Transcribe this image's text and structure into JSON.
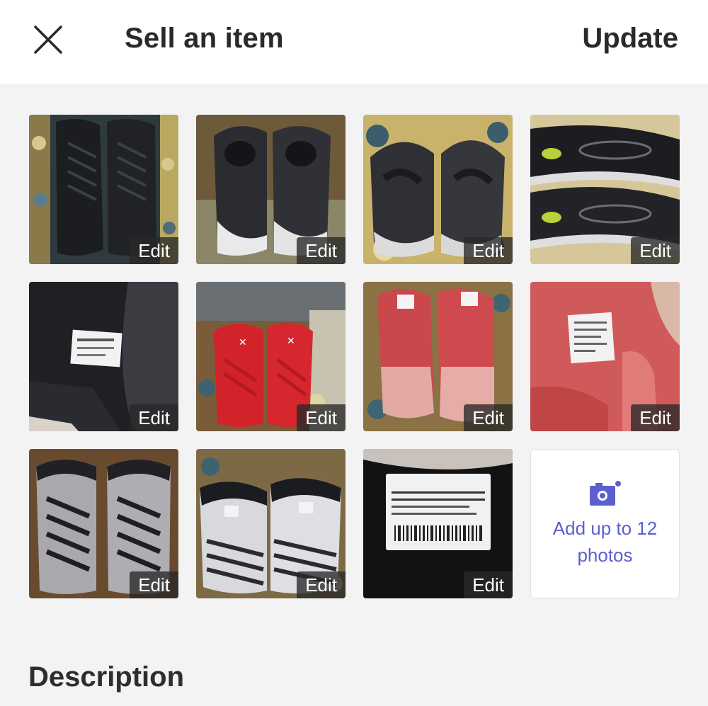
{
  "header": {
    "title": "Sell an item",
    "update_label": "Update"
  },
  "photos": [
    {
      "edit_label": "Edit",
      "subject": "black high-top sneakers, top view"
    },
    {
      "edit_label": "Edit",
      "subject": "black sneakers with white soles"
    },
    {
      "edit_label": "Edit",
      "subject": "black sneakers on patterned chair"
    },
    {
      "edit_label": "Edit",
      "subject": "sneaker soles"
    },
    {
      "edit_label": "Edit",
      "subject": "inside tag of black sneaker"
    },
    {
      "edit_label": "Edit",
      "subject": "red Under Armour sneakers"
    },
    {
      "edit_label": "Edit",
      "subject": "red knit high-tops"
    },
    {
      "edit_label": "Edit",
      "subject": "inside tag of red sneaker"
    },
    {
      "edit_label": "Edit",
      "subject": "grey and black Jordan sneakers"
    },
    {
      "edit_label": "Edit",
      "subject": "grey and white Jordan sneakers"
    },
    {
      "edit_label": "Edit",
      "subject": "Jordan size tag"
    }
  ],
  "add_photos": {
    "label": "Add up to 12 photos",
    "icon": "camera-plus-icon",
    "accent_color": "#5c5fcf"
  },
  "description_label": "Description"
}
